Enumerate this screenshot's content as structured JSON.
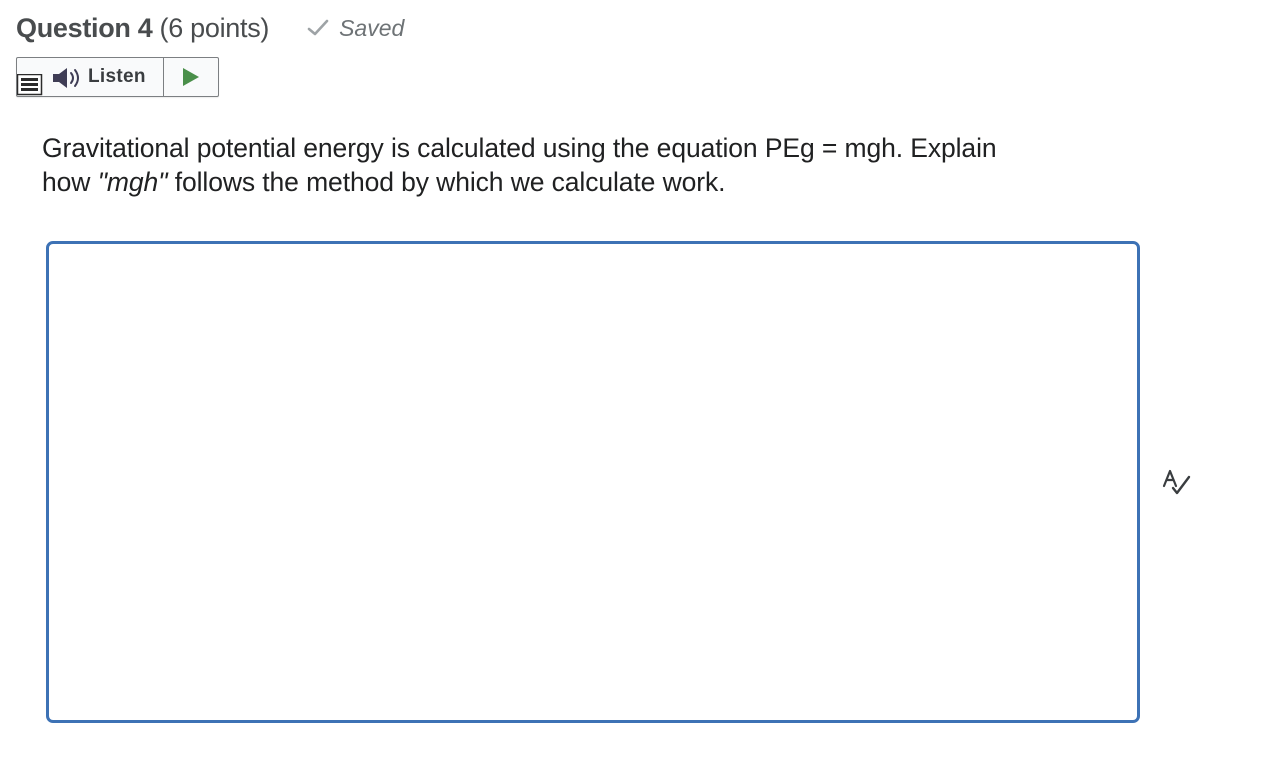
{
  "question": {
    "title": "Question 4",
    "points": "(6 points)",
    "status": "Saved",
    "prompt_line1_a": "Gravitational potential energy is calculated using the equation PEg = mgh.  Explain",
    "prompt_line2_a": "how ",
    "prompt_line2_em": "\"mgh\"",
    "prompt_line2_b": " follows the method by which we calculate work."
  },
  "listen_widget": {
    "label": "Listen",
    "icons": [
      "menu-icon",
      "speaker-icon",
      "play-icon"
    ]
  },
  "answer": {
    "value": ""
  },
  "icons": {
    "saved": "checkmark-icon",
    "spellcheck": "spellcheck-icon"
  },
  "colors": {
    "text": "#494c4e",
    "saved": "#6e7376",
    "answer_border": "#3d72b5",
    "play": "#4a8f4a",
    "speaker": "#3f3d55"
  }
}
